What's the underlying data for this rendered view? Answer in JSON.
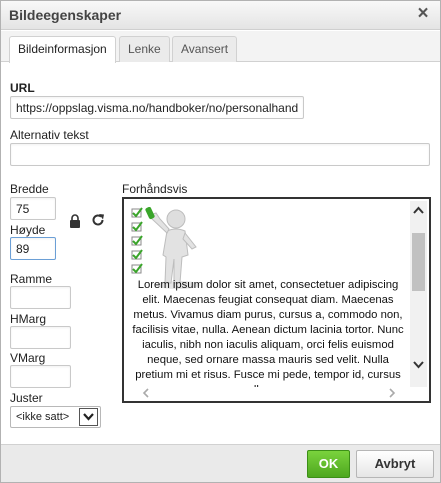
{
  "dialog": {
    "title": "Bildeegenskaper"
  },
  "tabs": [
    {
      "label": "Bildeinformasjon",
      "active": true
    },
    {
      "label": "Lenke",
      "active": false
    },
    {
      "label": "Avansert",
      "active": false
    }
  ],
  "url": {
    "label": "URL",
    "value": "https://oppslag.visma.no/handboker/no/personalhand"
  },
  "alt": {
    "label": "Alternativ tekst",
    "value": ""
  },
  "width": {
    "label": "Bredde",
    "value": "75"
  },
  "height": {
    "label": "Høyde",
    "value": "89"
  },
  "border": {
    "label": "Ramme",
    "value": ""
  },
  "hspace": {
    "label": "HMarg",
    "value": ""
  },
  "vspace": {
    "label": "VMarg",
    "value": ""
  },
  "align": {
    "label": "Juster",
    "selected": "<ikke satt>"
  },
  "preview": {
    "label": "Forhåndsvis",
    "text": "Lorem ipsum dolor sit amet, consectetuer adipiscing elit. Maecenas feugiat consequat diam. Maecenas metus. Vivamus diam purus, cursus a, commodo non, facilisis vitae, nulla. Aenean dictum lacinia tortor. Nunc iaculis, nibh non iaculis aliquam, orci felis euismod neque, sed ornare massa mauris sed velit. Nulla pretium mi et risus. Fusce mi pede, tempor id, cursus ac, ullamcorper"
  },
  "buttons": {
    "ok": "OK",
    "cancel": "Avbryt"
  },
  "colors": {
    "ok_green": "#5cb82a",
    "focus_blue": "#6b9fd6",
    "checkmark_green": "#3aa52a"
  },
  "icons": {
    "close": "close-icon",
    "lock": "lock-icon",
    "reset": "reset-size-icon"
  }
}
